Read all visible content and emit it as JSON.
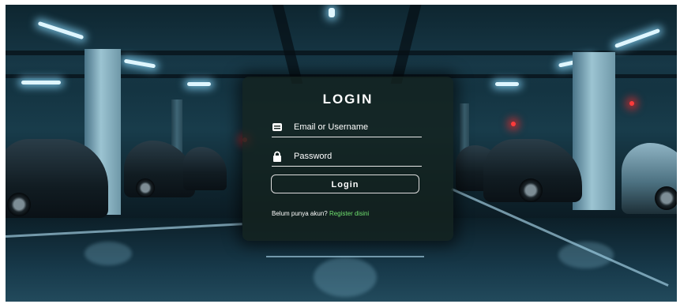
{
  "login": {
    "title": "LOGIN",
    "email_placeholder": "Email or Username",
    "password_placeholder": "Password",
    "button_label": "Login",
    "register_prompt": "Belum punya akun?",
    "register_link": "Register disini"
  },
  "icons": {
    "email": "envelope-icon",
    "password": "lock-icon"
  },
  "colors": {
    "card_background": "#14221e",
    "text": "#ffffff",
    "link": "#6fe06f",
    "border": "#dcdcdc"
  }
}
